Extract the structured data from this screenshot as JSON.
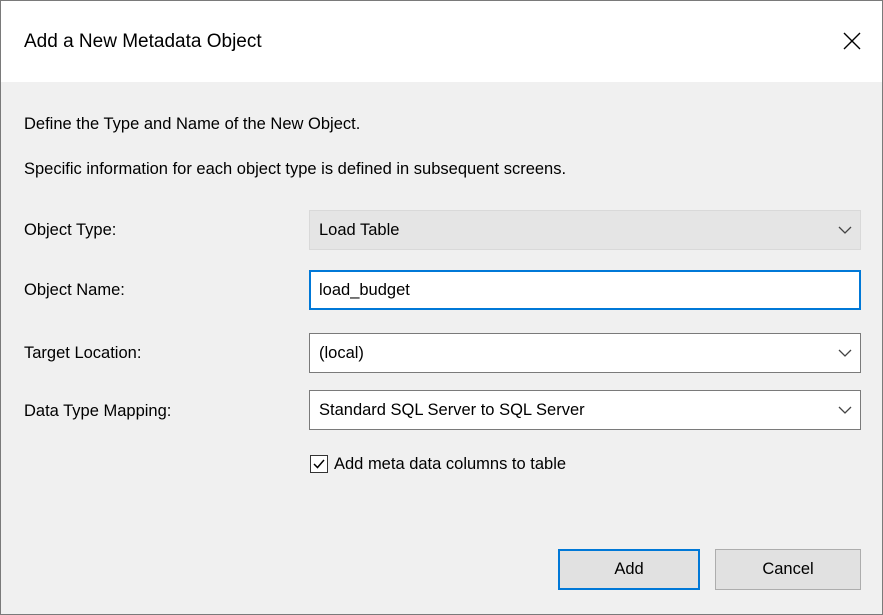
{
  "dialog": {
    "title": "Add a New Metadata Object",
    "close_icon": "close-icon"
  },
  "intro": {
    "line1": "Define the Type and Name of the New Object.",
    "line2": "Specific information for each object type is defined in subsequent screens."
  },
  "form": {
    "object_type": {
      "label": "Object Type:",
      "value": "Load Table",
      "enabled": false
    },
    "object_name": {
      "label": "Object Name:",
      "value": "load_budget"
    },
    "target_location": {
      "label": "Target Location:",
      "value": "(local)"
    },
    "data_type_mapping": {
      "label": "Data Type Mapping:",
      "value": "Standard SQL Server to SQL Server"
    },
    "meta_columns": {
      "label": "Add meta data columns to table",
      "checked": true
    }
  },
  "buttons": {
    "add_label": "Add",
    "cancel_label": "Cancel"
  },
  "colors": {
    "accent": "#0078d7",
    "dialog_bg": "#f0f0f0",
    "titlebar_bg": "#ffffff",
    "disabled_combo_bg": "#e5e5e5"
  }
}
